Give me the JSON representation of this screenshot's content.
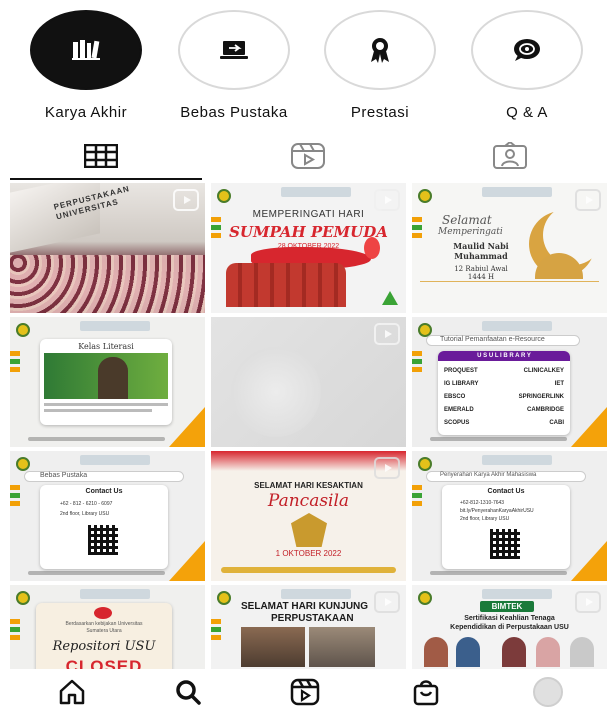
{
  "highlights": [
    {
      "label": "Karya Akhir",
      "icon": "books-icon",
      "active": true
    },
    {
      "label": "Bebas Pustaka",
      "icon": "laptop-plane-icon",
      "active": false
    },
    {
      "label": "Prestasi",
      "icon": "award-ribbon-icon",
      "active": false
    },
    {
      "label": "Q & A",
      "icon": "chat-bubble-icon",
      "active": false
    }
  ],
  "tabs": [
    {
      "name": "grid",
      "icon": "grid-icon",
      "active": true
    },
    {
      "name": "reels",
      "icon": "reels-icon",
      "active": false
    },
    {
      "name": "tagged",
      "icon": "tagged-person-icon",
      "active": false
    }
  ],
  "posts": {
    "p1": {
      "banner": "PERPUSTAKAAN UNIVERSITAS"
    },
    "p2": {
      "line1": "MEMPERINGATI HARI",
      "title": "SUMPAH PEMUDA",
      "date": "28 OKTOBER 2022"
    },
    "p3": {
      "line1": "Selamat",
      "line2": "Memperingati",
      "line3": "Maulid Nabi Muhammad",
      "line4": "12 Rabiul Awal 1444 H"
    },
    "p4": {
      "title": "Kelas Literasi"
    },
    "p6": {
      "search": "Tutorial Pemanfaatan e-Resource",
      "header": "U S U   L I B R A R Y",
      "resources": [
        "PROQUEST",
        "CLINICALKEY",
        "IG LIBRARY",
        "IET",
        "EBSCO",
        "SPRINGERLINK",
        "EMERALD",
        "CAMBRIDGE",
        "SCOPUS",
        "CABI"
      ]
    },
    "p7": {
      "search": "Bebas Pustaka",
      "heading": "Contact Us",
      "line1": "+62 - 812 - 6210 - 6097",
      "line2": "2nd floor, Library USU"
    },
    "p8": {
      "line1": "SELAMAT HARI KESAKTIAN",
      "title": "Pancasila",
      "date": "1 OKTOBER 2022"
    },
    "p9": {
      "search": "Penyerahan Karya Akhir Mahasiswa",
      "heading": "Contact Us",
      "line1": "+62-812-1310-7643",
      "line2": "bit.ly/PenyerahanKaryaAkhirUSU",
      "line3": "2nd floor, Library USU"
    },
    "p10": {
      "small": "Berdasarkan kebijakan Universitas Sumatera Utara",
      "title": "Repositori USU",
      "status": "CLOSED"
    },
    "p11": {
      "line1": "SELAMAT HARI KUNJUNG",
      "line2": "PERPUSTAKAAN"
    },
    "p12": {
      "badge": "BIMTEK",
      "line1": "Sertifikasi Keahlian Tenaga",
      "line2": "Kependidikan di Perpustakaan USU"
    }
  },
  "bottom_nav": [
    {
      "name": "home",
      "icon": "home-icon"
    },
    {
      "name": "search",
      "icon": "search-icon"
    },
    {
      "name": "reels",
      "icon": "reels-icon"
    },
    {
      "name": "shop",
      "icon": "shop-bag-icon"
    },
    {
      "name": "profile",
      "icon": "profile-avatar-icon"
    }
  ],
  "colors": {
    "accent_orange": "#f4a20a",
    "accent_green": "#3aa335",
    "red": "#d7262e",
    "usu_green": "#1a7a3a"
  }
}
